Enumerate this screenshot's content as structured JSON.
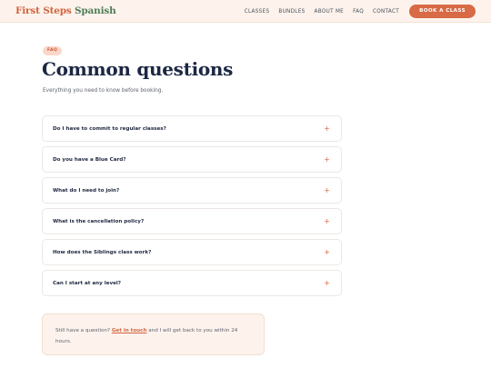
{
  "brand": {
    "part1": "First Steps",
    "part2": "Spanish"
  },
  "nav": {
    "links": [
      "CLASSES",
      "BUNDLES",
      "ABOUT ME",
      "FAQ",
      "CONTACT"
    ],
    "cta": "BOOK A CLASS"
  },
  "hero": {
    "badge": "FAQ",
    "title": "Common questions",
    "subtitle": "Everything you need to know before booking."
  },
  "faq": [
    {
      "question": "Do I have to commit to regular classes?",
      "toggle": "+"
    },
    {
      "question": "Do you have a Blue Card?",
      "toggle": "+"
    },
    {
      "question": "What do I need to join?",
      "toggle": "+"
    },
    {
      "question": "What is the cancellation policy?",
      "toggle": "+"
    },
    {
      "question": "How does the Siblings class work?",
      "toggle": "+"
    },
    {
      "question": "Can I start at any level?",
      "toggle": "+"
    }
  ],
  "contact": {
    "prefix": "Still have a question?",
    "link": "Get in touch",
    "suffix": "and I will get back to you within 24 hours."
  },
  "colors": {
    "accent": "#d86a45",
    "brand_green": "#4f7d5a",
    "header_bg": "#fdf3ec",
    "heading": "#1c2743"
  }
}
